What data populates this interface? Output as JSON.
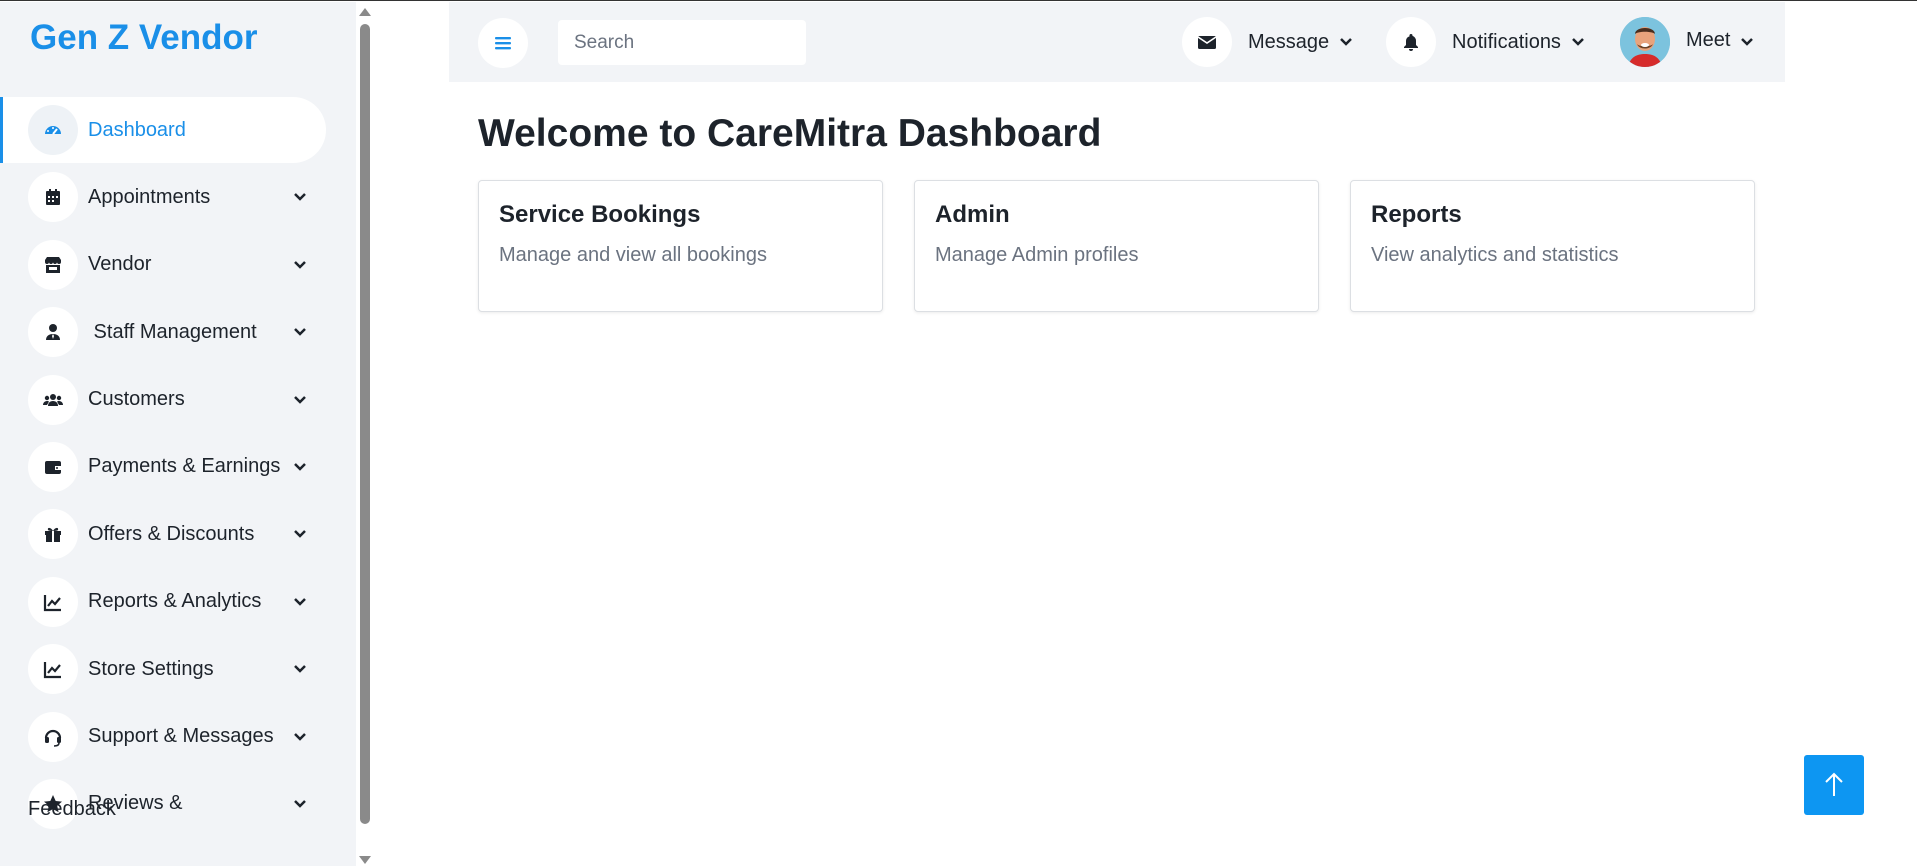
{
  "brand": {
    "name": "Gen Z Vendor",
    "color": "#1a8fe8"
  },
  "sidebar": {
    "items": [
      {
        "label": "Dashboard",
        "icon": "gauge-icon",
        "active": true
      },
      {
        "label": "Appointments",
        "icon": "calendar-icon"
      },
      {
        "label": "Vendor",
        "icon": "store-icon"
      },
      {
        "label": " Staff Management",
        "icon": "user-tie-icon"
      },
      {
        "label": "Customers",
        "icon": "users-icon"
      },
      {
        "label": "Payments & Earnings",
        "icon": "wallet-icon"
      },
      {
        "label": "Offers & Discounts",
        "icon": "gift-icon"
      },
      {
        "label": "Reports & Analytics",
        "icon": "chart-line-icon"
      },
      {
        "label": "Store Settings",
        "icon": "chart-line-icon"
      },
      {
        "label": "Support & Messages",
        "icon": "headset-icon"
      },
      {
        "label": "Reviews &",
        "label_tail": "Feedback",
        "icon": "star-icon"
      }
    ]
  },
  "topbar": {
    "search_placeholder": "Search",
    "message_label": "Message",
    "notifications_label": "Notifications",
    "user_name": "Meet"
  },
  "main": {
    "title": "Welcome to CareMitra Dashboard",
    "cards": [
      {
        "title": "Service Bookings",
        "text": "Manage and view all bookings"
      },
      {
        "title": "Admin",
        "text": "Manage Admin profiles"
      },
      {
        "title": "Reports",
        "text": "View analytics and statistics"
      }
    ]
  },
  "colors": {
    "accent": "#1a8fe8",
    "sidebar_bg": "#f2f4f7",
    "back_to_top": "#0d96f2"
  }
}
